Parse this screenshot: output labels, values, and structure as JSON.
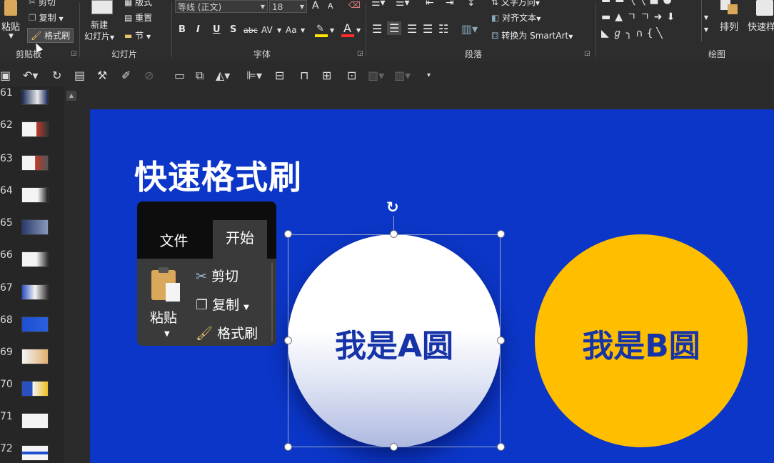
{
  "ribbon": {
    "clipboard": {
      "cut": "剪切",
      "copy": "复制",
      "paste": "粘贴",
      "format_painter": "格式刷",
      "group_label": "剪贴板"
    },
    "slides": {
      "new_slide": "新建\n幻灯片",
      "layout": "版式",
      "reset": "重置",
      "section": "节",
      "group_label": "幻灯片"
    },
    "font": {
      "font_name": "等线 (正文)",
      "font_size": "18",
      "bold": "B",
      "italic": "I",
      "underline": "U",
      "strike": "S",
      "abc": "abc",
      "av": "AV",
      "aa": "Aa",
      "grow": "A",
      "shrink": "A",
      "color": "A",
      "group_label": "字体"
    },
    "paragraph": {
      "text_direction": "文字方向",
      "align_text": "对齐文本",
      "convert_smartart": "转换为 SmartArt",
      "group_label": "段落"
    },
    "drawing": {
      "arrange": "排列",
      "quick_styles": "快速样",
      "group_label": "绘图"
    }
  },
  "slide_numbers": [
    "61",
    "62",
    "63",
    "64",
    "65",
    "66",
    "67",
    "68",
    "69",
    "70",
    "71",
    "72"
  ],
  "slide": {
    "title": "快速格式刷",
    "panel": {
      "tab_file": "文件",
      "tab_home": "开始",
      "paste": "粘贴",
      "cut": "剪切",
      "copy": "复制",
      "format_painter": "格式刷"
    },
    "circle_a_text": "我是A圆",
    "circle_b_text": "我是B圆"
  },
  "colors": {
    "slide_bg": "#0b36c7",
    "circle_b": "#ffbf00",
    "circle_text": "#1733a8",
    "ribbon_bg": "#2d2d2d"
  }
}
